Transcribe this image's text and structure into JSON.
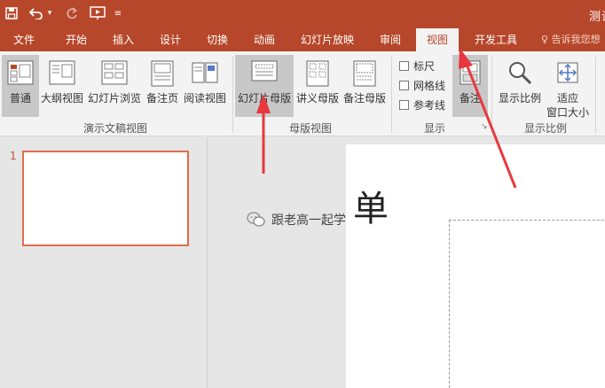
{
  "titlebar": {
    "quick_access": [
      "save-icon",
      "undo-icon",
      "dropdown-arrow-icon",
      "redo-icon",
      "slideshow-from-start-icon",
      "customize-quick-access-icon"
    ],
    "doc_title": "测试"
  },
  "tabs": [
    "文件",
    "开始",
    "插入",
    "设计",
    "切换",
    "动画",
    "幻灯片放映",
    "审阅",
    "视图",
    "开发工具"
  ],
  "active_tab": "视图",
  "tell_me": "告诉我您想",
  "ribbon": {
    "presentation_views": {
      "label": "演示文稿视图",
      "buttons": [
        "普通",
        "大纲视图",
        "幻灯片浏览",
        "备注页",
        "阅读视图"
      ],
      "selected": "普通"
    },
    "master_views": {
      "label": "母版视图",
      "buttons": [
        "幻灯片母版",
        "讲义母版",
        "备注母版"
      ],
      "highlighted": "幻灯片母版"
    },
    "show": {
      "label": "显示",
      "checkboxes": [
        "标尺",
        "网格线",
        "参考线"
      ],
      "notes_button": "备注"
    },
    "zoom": {
      "label": "显示比例",
      "buttons": [
        "显示比例",
        "适应",
        "窗口大小"
      ]
    }
  },
  "slides_pane": {
    "slide_number": "1"
  },
  "canvas": {
    "partial_char": "单",
    "watermark": "跟老高一起学"
  },
  "colors": {
    "accent": "#b7472a",
    "arrow": "#e8383d",
    "thumb_border": "#e06c4a"
  }
}
